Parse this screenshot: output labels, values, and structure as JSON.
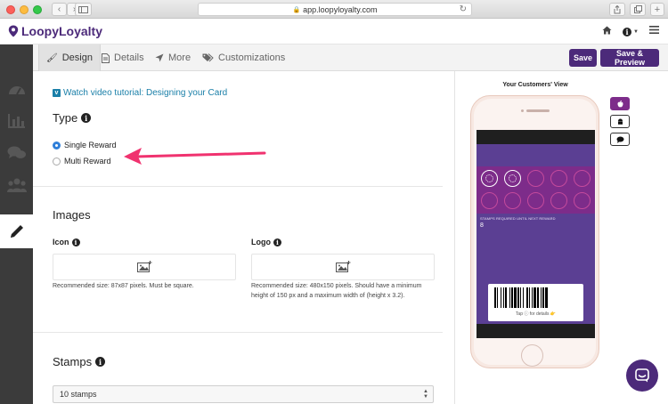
{
  "browser": {
    "url": "app.loopyloyalty.com",
    "back_icon": "chevron-left-icon",
    "forward_icon": "chevron-right-icon"
  },
  "app": {
    "brand": "LoopyLoyalty",
    "brand_color": "#4c2a7a"
  },
  "tabs": [
    {
      "label": "Design",
      "icon": "brush-icon",
      "active": true
    },
    {
      "label": "Details",
      "icon": "document-icon",
      "active": false
    },
    {
      "label": "More",
      "icon": "location-arrow-icon",
      "active": false
    },
    {
      "label": "Customizations",
      "icon": "tags-icon",
      "active": false
    }
  ],
  "actions": {
    "save": "Save",
    "save_preview": "Save & Preview"
  },
  "main": {
    "tutorial_link": "Watch video tutorial: Designing your Card",
    "type": {
      "title": "Type",
      "options": [
        {
          "label": "Single Reward",
          "selected": true
        },
        {
          "label": "Multi Reward",
          "selected": false
        }
      ]
    },
    "images": {
      "title": "Images",
      "icon": {
        "label": "Icon",
        "hint": "Recommended size: 87x87 pixels. Must be square."
      },
      "logo": {
        "label": "Logo",
        "hint_line1": "Recommended size: 480x150 pixels. Should have a minimum",
        "hint_line2": "height of 150 px and a maximum width of (height x 3.2)."
      }
    },
    "stamps": {
      "title": "Stamps",
      "selected": "10 stamps"
    }
  },
  "preview": {
    "title": "Your Customers' View",
    "stamps_total": 10,
    "stamps_filled": 2,
    "card_label": "STAMPS REQUIRED UNTIL NEXT REWARD",
    "card_value": "8",
    "tap_text": "Tap ⓘ for details 👉",
    "platforms": [
      "apple-icon",
      "android-icon",
      "message-icon"
    ]
  }
}
